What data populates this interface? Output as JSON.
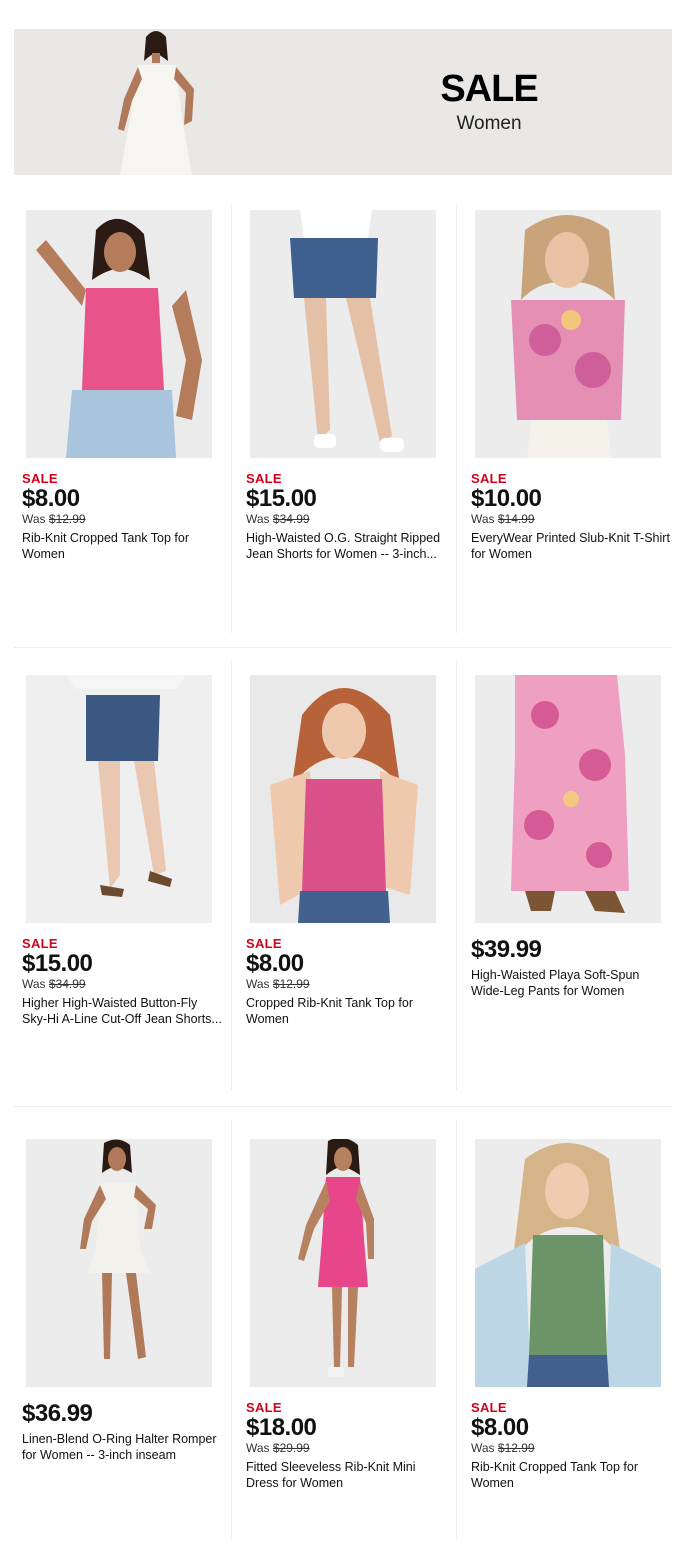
{
  "banner": {
    "title": "SALE",
    "subtitle": "Women"
  },
  "products": [
    {
      "sale_label": "SALE",
      "price": "$8.00",
      "was_label": "Was",
      "was_price": "$12.99",
      "name": "Rib-Knit Cropped Tank Top for Women",
      "accent": "#e8538a"
    },
    {
      "sale_label": "SALE",
      "price": "$15.00",
      "was_label": "Was",
      "was_price": "$34.99",
      "name": "High-Waisted O.G. Straight Ripped Jean Shorts for Women -- 3-inch...",
      "accent": "#3f5f8f"
    },
    {
      "sale_label": "SALE",
      "price": "$10.00",
      "was_label": "Was",
      "was_price": "$14.99",
      "name": "EveryWear Printed Slub-Knit T-Shirt for Women",
      "accent": "#e58fb5"
    },
    {
      "sale_label": "SALE",
      "price": "$15.00",
      "was_label": "Was",
      "was_price": "$34.99",
      "name": "Higher High-Waisted Button-Fly Sky-Hi A-Line Cut-Off Jean Shorts...",
      "accent": "#3b5883"
    },
    {
      "sale_label": "SALE",
      "price": "$8.00",
      "was_label": "Was",
      "was_price": "$12.99",
      "name": "Cropped Rib-Knit Tank Top for Women",
      "accent": "#d9508a"
    },
    {
      "sale_label": "",
      "price": "$39.99",
      "was_label": "",
      "was_price": "",
      "name": "High-Waisted Playa Soft-Spun Wide-Leg Pants for Women",
      "accent": "#ef9fc0"
    },
    {
      "sale_label": "",
      "price": "$36.99",
      "was_label": "",
      "was_price": "",
      "name": "Linen-Blend O-Ring Halter Romper for Women -- 3-inch inseam",
      "accent": "#f3f1ec"
    },
    {
      "sale_label": "SALE",
      "price": "$18.00",
      "was_label": "Was",
      "was_price": "$29.99",
      "name": "Fitted Sleeveless Rib-Knit Mini Dress for Women",
      "accent": "#e8468b"
    },
    {
      "sale_label": "SALE",
      "price": "$8.00",
      "was_label": "Was",
      "was_price": "$12.99",
      "name": "Rib-Knit Cropped Tank Top for Women",
      "accent": "#6b9468"
    }
  ]
}
